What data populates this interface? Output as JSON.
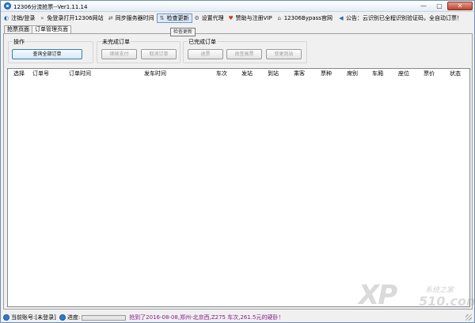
{
  "window": {
    "title": "12306分流抢票--Ver1.11.14",
    "controls": [
      "—",
      "▢",
      "✕"
    ]
  },
  "toolbar": {
    "items": [
      {
        "label": "注销/登录",
        "icon": "logout-icon"
      },
      {
        "label": "免登录打开12306网站",
        "icon": "open-link-icon"
      },
      {
        "label": "同步服务器时间",
        "icon": "sync-icon"
      },
      {
        "label": "检查更新",
        "icon": "update-icon"
      },
      {
        "label": "设置代理",
        "icon": "gear-icon"
      },
      {
        "label": "赞助与注册VIP",
        "icon": "heart-icon"
      },
      {
        "label": "12306Bypass官网",
        "icon": "home-icon"
      }
    ],
    "notice": "公告：云识别已全程识别验证码，全自动订票！"
  },
  "tooltip": "检查更新",
  "tabs": [
    "抢票页面",
    "订单管理页面"
  ],
  "groups": {
    "ops": {
      "label": "操作",
      "query_btn": "查询全部订单"
    },
    "pending": {
      "label": "未完成订单",
      "continue_btn": "继续支付",
      "cancel_btn": "取消订单"
    },
    "done": {
      "label": "已完成订单",
      "refund_btn": "退票",
      "change_btn": "改签高票",
      "change_station_btn": "变更到站"
    }
  },
  "table": {
    "columns": [
      "选择",
      "订单号",
      "订单时间",
      "发车时间",
      "车次",
      "发站",
      "到站",
      "乘客",
      "票种",
      "席别",
      "车厢",
      "座位",
      "票价",
      "状态"
    ]
  },
  "statusbar": {
    "account": "当前账号:[未登录]",
    "progress_label": "进度:",
    "progress": 0,
    "message": "抢到了2016-08-08,郑州-北京西,Z275 车次,261.5元的硬卧！"
  },
  "watermark": {
    "brand": "XP",
    "site_cn": "系统之家",
    "site_num": "510.com"
  }
}
